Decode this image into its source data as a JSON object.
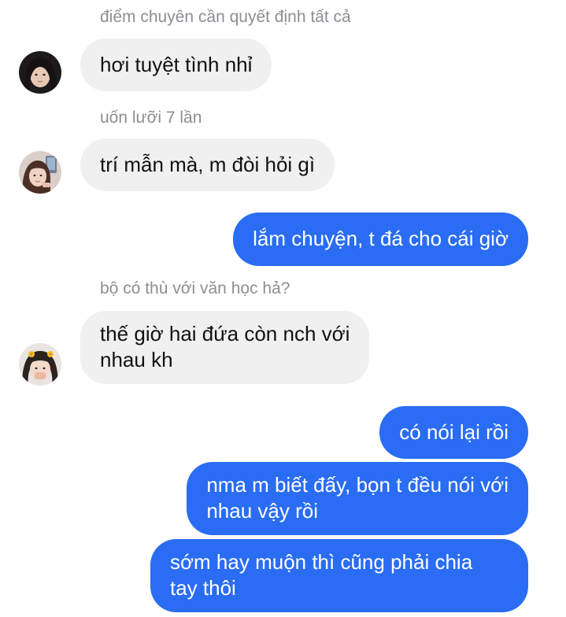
{
  "colors": {
    "incoming_bubble": "#f0f0f0",
    "outgoing_bubble": "#2a6df4",
    "sender_name": "#8e8e93"
  },
  "messages": [
    {
      "sender": "điểm chuyên cần quyết định tất cả",
      "avatar": "avatar-girl-dark-hair-icon",
      "lines": [
        "hơi tuyệt tình nhỉ"
      ]
    },
    {
      "sender": "uốn lưỡi 7 lần",
      "avatar": "avatar-girl-selfie-icon",
      "lines": [
        "trí mẫn mà, m đòi hỏi gì"
      ]
    },
    {
      "sender": "",
      "avatar": "",
      "lines": [
        "lắm chuyện, t đá cho cái giờ"
      ]
    },
    {
      "sender": "bộ có thù với văn học hả?",
      "avatar": "avatar-girl-flower-clip-icon",
      "lines": [
        "thế giờ hai đứa còn nch với",
        "nhau kh"
      ]
    },
    {
      "sender": "",
      "avatar": "",
      "lines": [
        "có nói lại rồi"
      ]
    },
    {
      "sender": "",
      "avatar": "",
      "lines": [
        "nma m biết đấy, bọn t đều nói với",
        "nhau vậy rồi"
      ]
    },
    {
      "sender": "",
      "avatar": "",
      "lines": [
        "sớm hay muộn thì cũng phải chia",
        "tay thôi"
      ]
    }
  ]
}
